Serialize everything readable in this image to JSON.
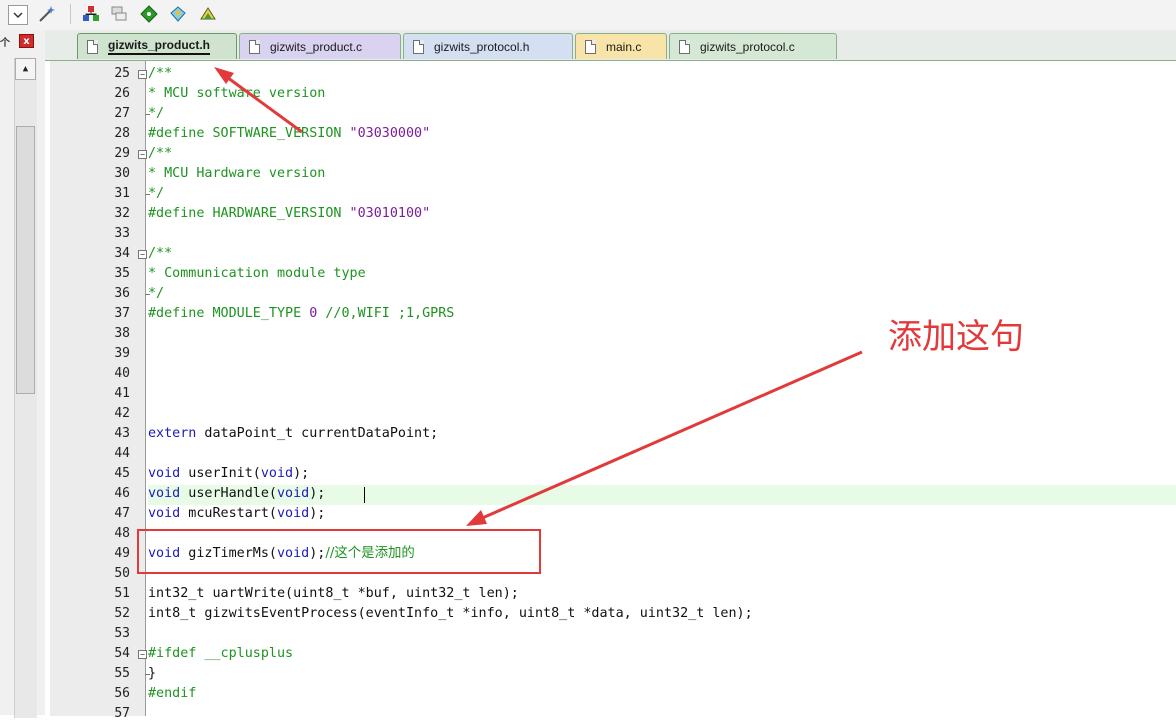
{
  "toolbar": {
    "icons": [
      "dropdown-icon",
      "magic-wand-icon",
      "component-stack-icon",
      "window-stack-icon",
      "green-diamond-icon",
      "manage-icon",
      "project-book-icon"
    ]
  },
  "panel": {
    "pin_label": "个",
    "close_label": "x",
    "scroll_up": "▲"
  },
  "tabs": [
    {
      "label": "gizwits_product.h",
      "active": true,
      "color": "#cfe3cf"
    },
    {
      "label": "gizwits_product.c",
      "active": false,
      "color": "#d9d2f0"
    },
    {
      "label": "gizwits_protocol.h",
      "active": false,
      "color": "#d4e0f2"
    },
    {
      "label": "main.c",
      "active": false,
      "color": "#f8e4a8"
    },
    {
      "label": "gizwits_protocol.c",
      "active": false,
      "color": "#d5e8d5"
    }
  ],
  "editor": {
    "line_numbers": [
      "25",
      "26",
      "27",
      "28",
      "29",
      "30",
      "31",
      "32",
      "33",
      "34",
      "35",
      "36",
      "37",
      "38",
      "39",
      "40",
      "41",
      "42",
      "43",
      "44",
      "45",
      "46",
      "47",
      "48",
      "49",
      "50",
      "51",
      "52",
      "53",
      "54",
      "55",
      "56",
      "57"
    ],
    "code": {
      "l25": "/**",
      "l26": "* MCU software version",
      "l27": "*/",
      "l28_a": "#define SOFTWARE_VERSION ",
      "l28_b": "\"03030000\"",
      "l29": "/**",
      "l30": "* MCU Hardware version",
      "l31": "*/",
      "l32_a": "#define HARDWARE_VERSION ",
      "l32_b": "\"03010100\"",
      "l34": "/**",
      "l35": "* Communication module type",
      "l36": "*/",
      "l37_a": "#define MODULE_TYPE ",
      "l37_b": "0",
      "l37_c": " //0,WIFI ;1,GPRS",
      "l43_a": "extern",
      "l43_b": " dataPoint_t currentDataPoint;",
      "l45_a": "void",
      "l45_b": " userInit(",
      "l45_c": "void",
      "l45_d": ");",
      "l46_a": "void",
      "l46_b": " userHandle(",
      "l46_c": "void",
      "l46_d": ");",
      "l47_a": "void",
      "l47_b": " mcuRestart(",
      "l47_c": "void",
      "l47_d": ");",
      "l49_a": "void",
      "l49_b": " gizTimerMs(",
      "l49_c": "void",
      "l49_d": ");",
      "l49_e": "//这个是添加的",
      "l51": "int32_t uartWrite(uint8_t *buf, uint32_t len);",
      "l52": "int8_t gizwitsEventProcess(eventInfo_t *info, uint8_t *data, uint32_t len);",
      "l54": "#ifdef __cplusplus",
      "l55": "}",
      "l56": "#endif"
    }
  },
  "annotation": {
    "text": "添加这句",
    "color": "#e23a3a"
  }
}
